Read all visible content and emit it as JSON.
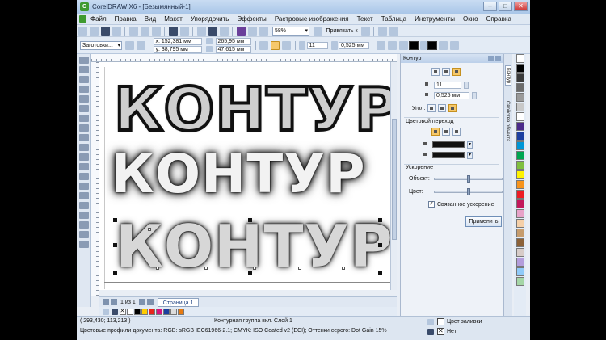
{
  "window": {
    "title": "CorelDRAW X6 - [Безымянный-1]"
  },
  "menu": [
    "Файл",
    "Правка",
    "Вид",
    "Макет",
    "Упорядочить",
    "Эффекты",
    "Растровые изображения",
    "Текст",
    "Таблица",
    "Инструменты",
    "Окно",
    "Справка"
  ],
  "toolbar": {
    "zoom": "58%",
    "snap_label": "Привязать к"
  },
  "propbar": {
    "preset": "Заготовки...",
    "x": "x: 152,381 мм",
    "y": "y: 38,795 мм",
    "w": "265,95 мм",
    "h": "47,615 мм",
    "steps": "11",
    "offset": "0,525 мм"
  },
  "docker": {
    "title": "Контур",
    "steps": "11",
    "offset": "0,525 мм",
    "angle_label": "Угол:",
    "color_transition_label": "Цветовой переход",
    "accel_label": "Ускорение",
    "object_label": "Объект:",
    "color_label": "Цвет:",
    "linked_label": "Связанное ускорение",
    "apply_label": "Применить",
    "tab_contour": "Контур",
    "tab_props": "Свойства объекта"
  },
  "canvas": {
    "word": "КОНТУР"
  },
  "pages": {
    "counter": "1 из 1",
    "tab": "Страница 1"
  },
  "status": {
    "coords": "( 293,430; 113,213 )",
    "info": "Контурная группа вкл. Слой 1",
    "profiles": "Цветовые профили документа: RGB: sRGB IEC61966-2.1; CMYK: ISO Coated v2 (ECI); Оттенки серого: Dot Gain 15%",
    "fill": "Цвет заливки",
    "outline": "Нет"
  },
  "colors": {
    "bottom_palette": [
      "#ffffff",
      "#000000",
      "#ffcc00",
      "#e8261c",
      "#d6157f",
      "#1b3fa0",
      "#dcdcdc",
      "#e87a10"
    ],
    "right_palette": [
      "#ffffff",
      "#000000",
      "#3a3a3a",
      "#6b6b6b",
      "#9a9a9a",
      "#c8c8c8",
      "#ffffff",
      "#4a2a8a",
      "#1b3fa0",
      "#0096d6",
      "#00a651",
      "#7fbf3f",
      "#fff200",
      "#f7941d",
      "#ed1c24",
      "#c2185b",
      "#e8a3c9",
      "#f5d0a9",
      "#c69c6d",
      "#8c6239",
      "#d7ccc8",
      "#b39ddb",
      "#90caf9",
      "#a5d6a7"
    ]
  }
}
